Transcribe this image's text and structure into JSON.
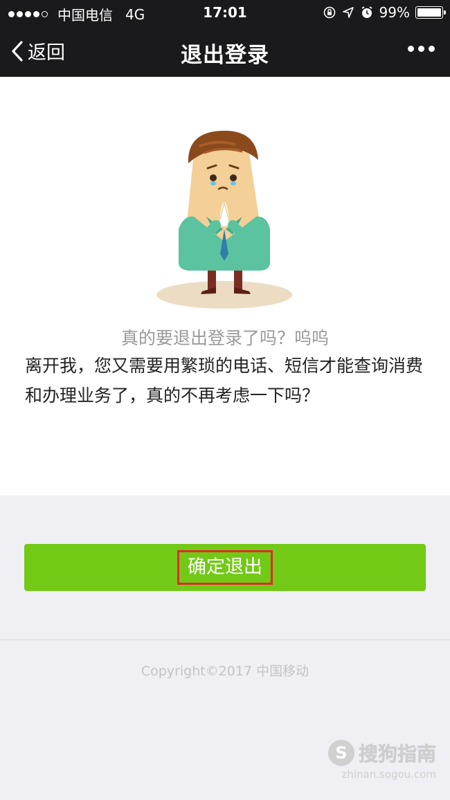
{
  "status_bar": {
    "carrier": "中国电信",
    "network": "4G",
    "time": "17:01",
    "battery": "99%",
    "battery_level": 0.99,
    "icons": [
      "signal-icon",
      "rotation-lock-icon",
      "location-icon",
      "alarm-icon",
      "battery-icon"
    ]
  },
  "nav": {
    "back_label": "返回",
    "title": "退出登录",
    "more_icon": "more-icon"
  },
  "content": {
    "subtitle": "真的要退出登录了吗？呜呜",
    "body": "离开我，您又需要用繁琐的电话、短信才能查询消费和办理业务了，真的不再考虑一下吗？"
  },
  "actions": {
    "confirm_label": "确定退出",
    "confirm_color": "#72c916",
    "highlight_color": "#e12a2a"
  },
  "footer": {
    "copyright": "Copyright©2017 中国移动"
  },
  "watermark": {
    "logo": "S",
    "name": "搜狗指南",
    "url": "zhinan.sogou.com"
  }
}
